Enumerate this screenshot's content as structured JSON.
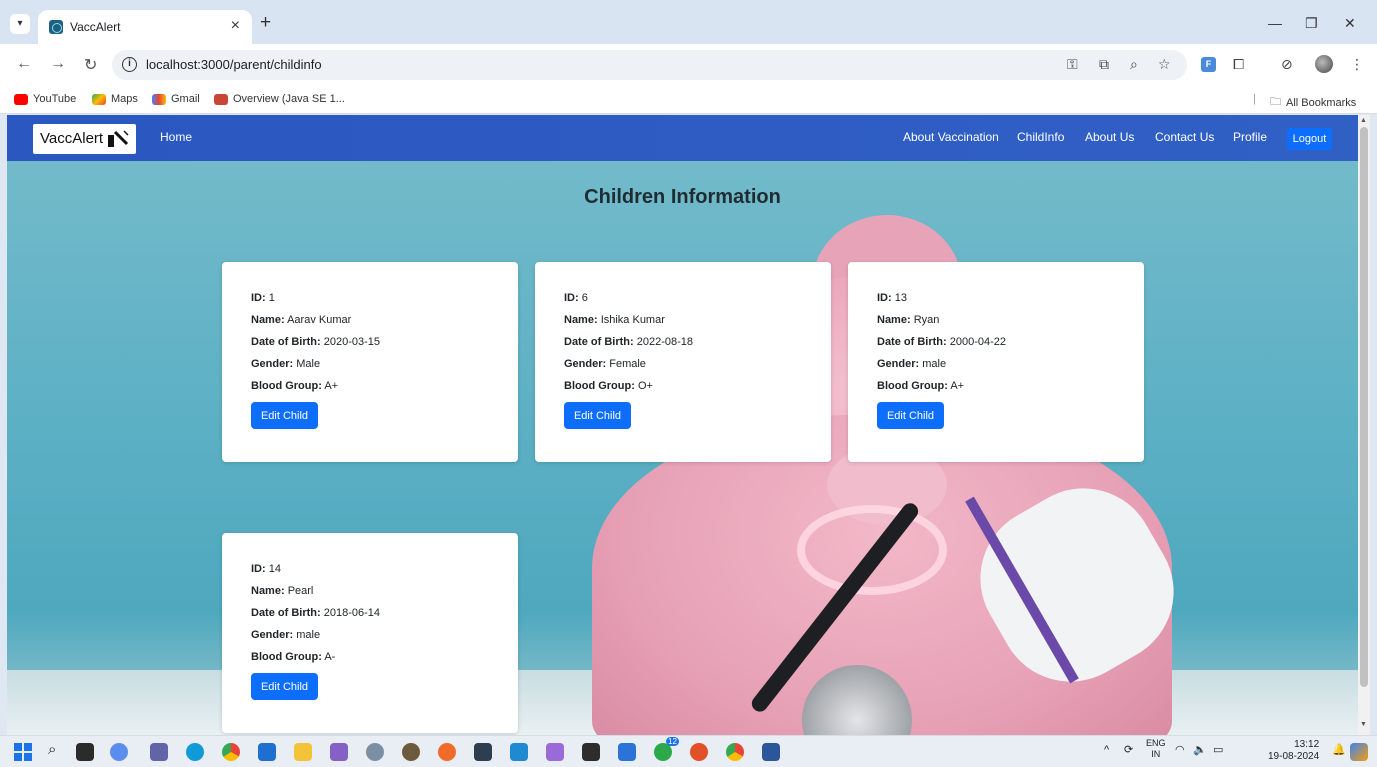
{
  "browser": {
    "tab_title": "VaccAlert",
    "tab_close": "×",
    "new_tab": "+",
    "url": "localhost:3000/parent/childinfo",
    "bookmarks": [
      "YouTube",
      "Maps",
      "Gmail",
      "Overview (Java SE 1..."
    ],
    "all_bookmarks": "All Bookmarks",
    "extension_letter": "F"
  },
  "navbar": {
    "brand": "VaccAlert",
    "home": "Home",
    "links": [
      "About Vaccination",
      "ChildInfo",
      "About Us",
      "Contact Us",
      "Profile"
    ],
    "logout": "Logout"
  },
  "page": {
    "title": "Children Information",
    "labels": {
      "id": "ID:",
      "name": "Name:",
      "dob": "Date of Birth:",
      "gender": "Gender:",
      "blood": "Blood Group:"
    },
    "edit_label": "Edit Child"
  },
  "children": [
    {
      "id": "1",
      "name": "Aarav Kumar",
      "dob": "2020-03-15",
      "gender": "Male",
      "blood": "A+"
    },
    {
      "id": "6",
      "name": "Ishika Kumar",
      "dob": "2022-08-18",
      "gender": "Female",
      "blood": "O+"
    },
    {
      "id": "13",
      "name": "Ryan",
      "dob": "2000-04-22",
      "gender": "male",
      "blood": "A+"
    },
    {
      "id": "14",
      "name": "Pearl",
      "dob": "2018-06-14",
      "gender": "male",
      "blood": "A-"
    }
  ],
  "taskbar": {
    "lang_top": "ENG",
    "lang_bottom": "IN",
    "time": "13:12",
    "date": "19-08-2024",
    "notification_count": "12"
  },
  "colors": {
    "navbar": "#2a57c0",
    "button": "#0d6efd",
    "background": "#5fb1c5"
  }
}
